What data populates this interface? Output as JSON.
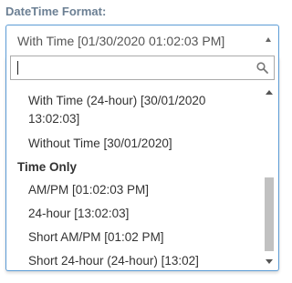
{
  "field": {
    "label": "DateTime Format:"
  },
  "select": {
    "selected": "With Time [01/30/2020 01:02:03 PM]"
  },
  "search": {
    "value": "",
    "placeholder": ""
  },
  "options": {
    "with_time_24": "With Time (24-hour) [30/01/2020 13:02:03]",
    "without_time": "Without Time [30/01/2020]",
    "group_time_only": "Time Only",
    "am_pm": "AM/PM [01:02:03 PM]",
    "hour24": "24-hour [13:02:03]",
    "short_am_pm": "Short AM/PM [01:02 PM]",
    "short_24": "Short 24-hour (24-hour) [13:02]"
  },
  "icons": {
    "search": "search-icon",
    "select_arrow": "chevron-up-icon",
    "scroll_up": "chevron-up-icon",
    "scroll_down": "chevron-down-icon"
  },
  "colors": {
    "label": "#6b7f93",
    "focus_border": "#5b9bd5",
    "scroll_thumb": "#c1c1c1"
  }
}
